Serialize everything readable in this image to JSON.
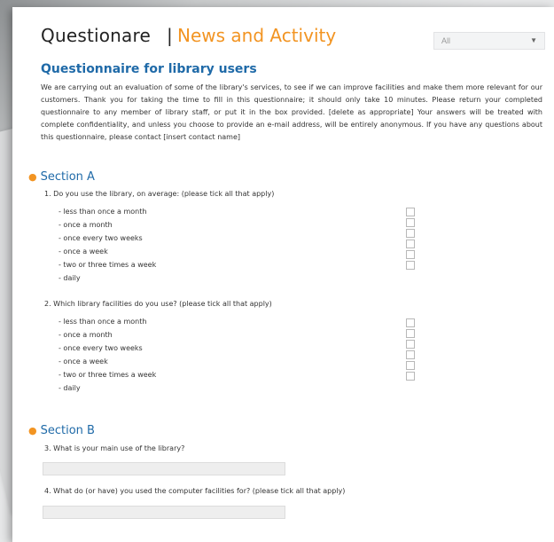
{
  "header": {
    "title": "Questionare",
    "separator": "|",
    "subtitle": "News and Activity",
    "filter_value": "All",
    "filter_arrow": "▼"
  },
  "intro": {
    "title": "Questionnaire for library users",
    "text": "We are carrying out an evaluation of some of the library's services, to see if we can improve facilities and make them more relevant for our customers. Thank you for taking the time to fill in this questionnaire; it should only take 10 minutes. Please return your completed questionnaire to any member of library staff, or put it in the box provided. [delete as appropriate] Your answers will be treated with complete confidentiality, and unless you choose to provide an e-mail address, will be entirely anonymous. If you have any questions about this questionnaire, please contact [insert contact name]"
  },
  "sectionA": {
    "title": "Section A",
    "q1": {
      "text": "1. Do you use the library, on average: (please tick all that apply)",
      "options": [
        "- less than once a month",
        "- once a month",
        "- once every two weeks",
        "- once a week",
        "- two or three times a week",
        "- daily"
      ]
    },
    "q2": {
      "text": "2. Which library facilities do you use? (please tick all that apply)",
      "options": [
        "- less than once a month",
        "- once a month",
        "- once every two weeks",
        "- once a week",
        "- two or three times a week",
        "- daily"
      ]
    }
  },
  "sectionB": {
    "title": "Section B",
    "q3": {
      "text": "3. What is your main use of the library?"
    },
    "q4": {
      "text": "4. What do (or have) you used the computer facilities for? (please tick all that apply)"
    }
  },
  "colors": {
    "accent_orange": "#f29422",
    "heading_blue": "#1f6aa8"
  }
}
